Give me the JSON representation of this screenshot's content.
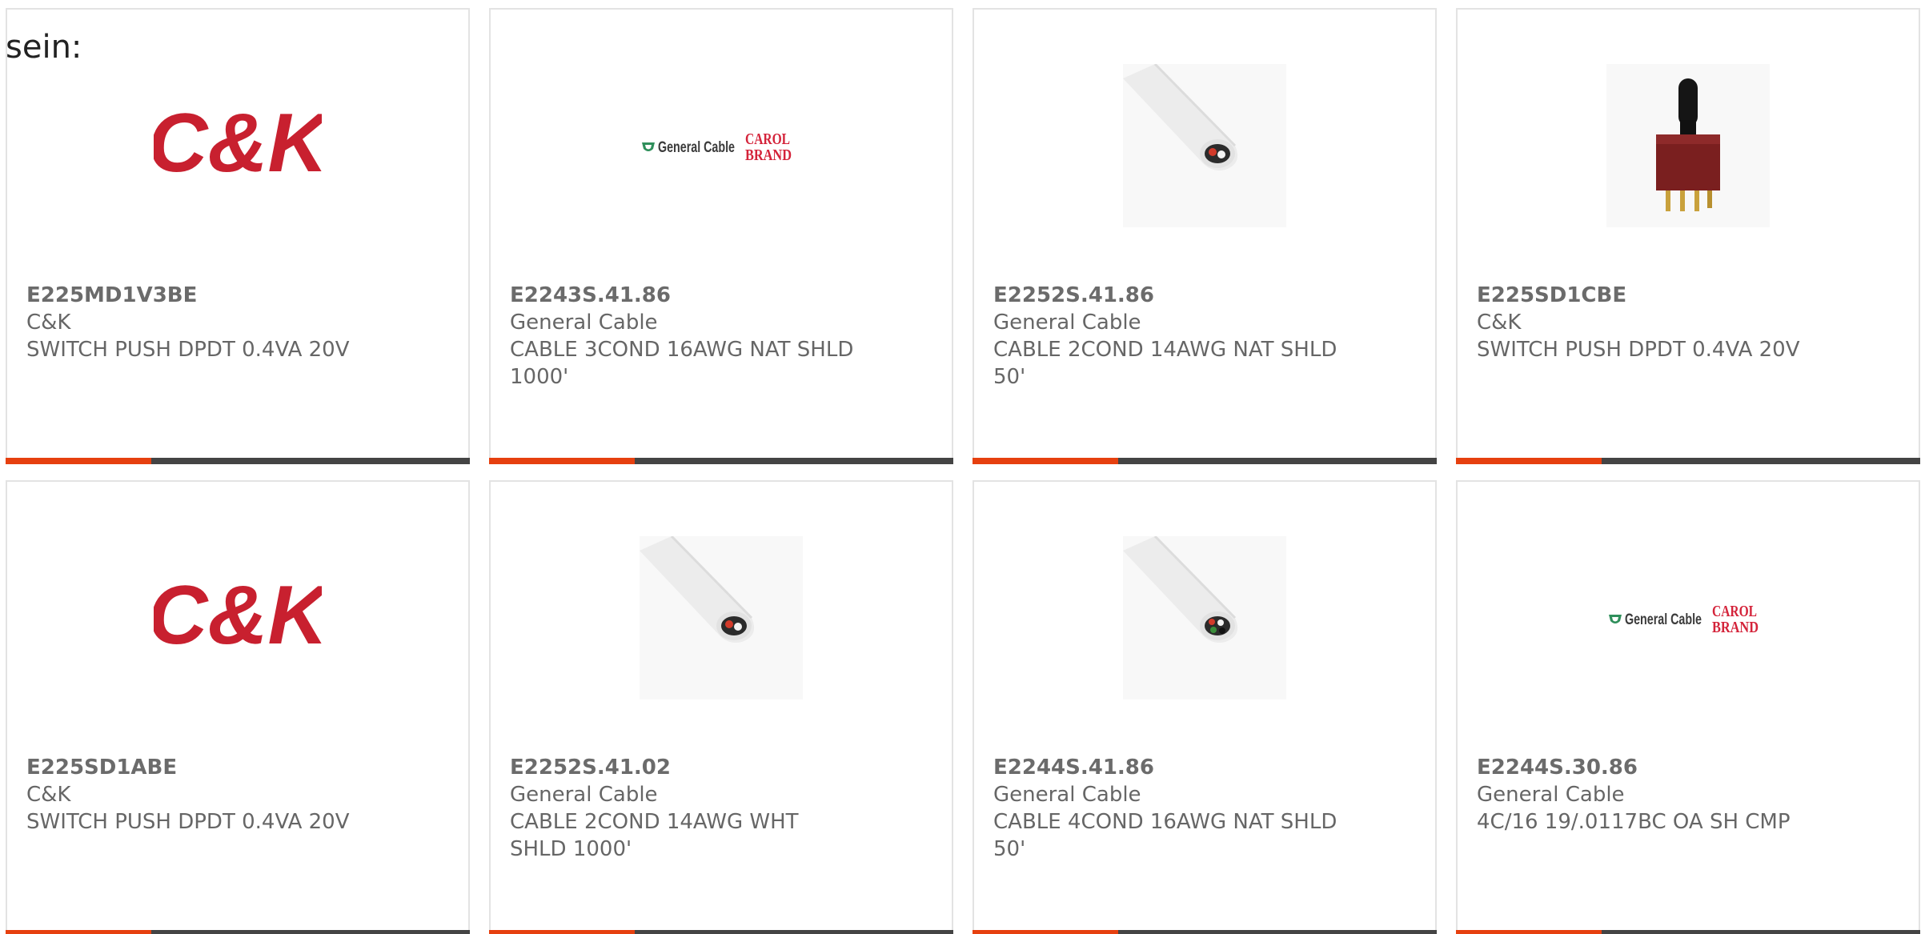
{
  "intro_text": "sein:",
  "colors": {
    "accent": "#e6400f",
    "bar": "#444444",
    "card_border": "#e3e3e3",
    "ck_red": "#c8202f",
    "general_cable_green": "#2f8f5b"
  },
  "logos": {
    "ck": "C&K",
    "general_cable": "General Cable",
    "carol_line1": "CAROL",
    "carol_line2": "BRAND"
  },
  "products": [
    {
      "part_number": "E225MD1V3BE",
      "manufacturer": "C&K",
      "description": "SWITCH PUSH DPDT 0.4VA 20V",
      "image": "ck-logo"
    },
    {
      "part_number": "E2243S.41.86",
      "manufacturer": "General Cable",
      "description": "CABLE 3COND 16AWG NAT SHLD 1000'",
      "image": "general-cable-logo"
    },
    {
      "part_number": "E2252S.41.86",
      "manufacturer": "General Cable",
      "description": "CABLE 2COND 14AWG NAT SHLD 50'",
      "image": "white-cable-photo"
    },
    {
      "part_number": "E225SD1CBE",
      "manufacturer": "C&K",
      "description": "SWITCH PUSH DPDT 0.4VA 20V",
      "image": "push-switch-photo"
    },
    {
      "part_number": "E225SD1ABE",
      "manufacturer": "C&K",
      "description": "SWITCH PUSH DPDT 0.4VA 20V",
      "image": "ck-logo"
    },
    {
      "part_number": "E2252S.41.02",
      "manufacturer": "General Cable",
      "description": "CABLE 2COND 14AWG WHT SHLD 1000'",
      "image": "white-cable-photo"
    },
    {
      "part_number": "E2244S.41.86",
      "manufacturer": "General Cable",
      "description": "CABLE 4COND 16AWG NAT SHLD 50'",
      "image": "white-cable-photo"
    },
    {
      "part_number": "E2244S.30.86",
      "manufacturer": "General Cable",
      "description": "4C/16 19/.0117BC OA SH CMP",
      "image": "general-cable-logo"
    }
  ]
}
